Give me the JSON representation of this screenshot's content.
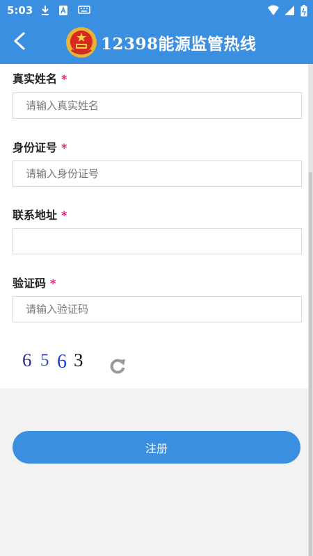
{
  "status_bar": {
    "time": "5:03",
    "icons": [
      "download-icon",
      "app-notification-icon",
      "keyboard-icon",
      "wifi-icon",
      "signal-icon",
      "battery-icon"
    ]
  },
  "header": {
    "title": "12398能源监管热线",
    "icons": [
      "back-arrow-icon",
      "national-emblem-icon"
    ]
  },
  "form": {
    "fields": [
      {
        "label": "真实姓名",
        "required_mark": "*",
        "value": "",
        "placeholder": "请输入真实姓名"
      },
      {
        "label": "身份证号",
        "required_mark": "*",
        "value": "",
        "placeholder": "请输入身份证号"
      },
      {
        "label": "联系地址",
        "required_mark": "*",
        "value": "",
        "placeholder": ""
      },
      {
        "label": "验证码",
        "required_mark": "*",
        "value": "",
        "placeholder": "请输入验证码"
      }
    ],
    "captcha": {
      "digits": [
        "6",
        "5",
        "6",
        "3"
      ],
      "colors": [
        "#2b2f9a",
        "#3a4aa8",
        "#1f3fd0",
        "#111111"
      ]
    },
    "refresh_icon": "refresh-icon"
  },
  "actions": {
    "register_label": "注册"
  },
  "colors": {
    "primary": "#3a8fe0",
    "required": "#e0277a",
    "background": "#f2f2f2"
  }
}
